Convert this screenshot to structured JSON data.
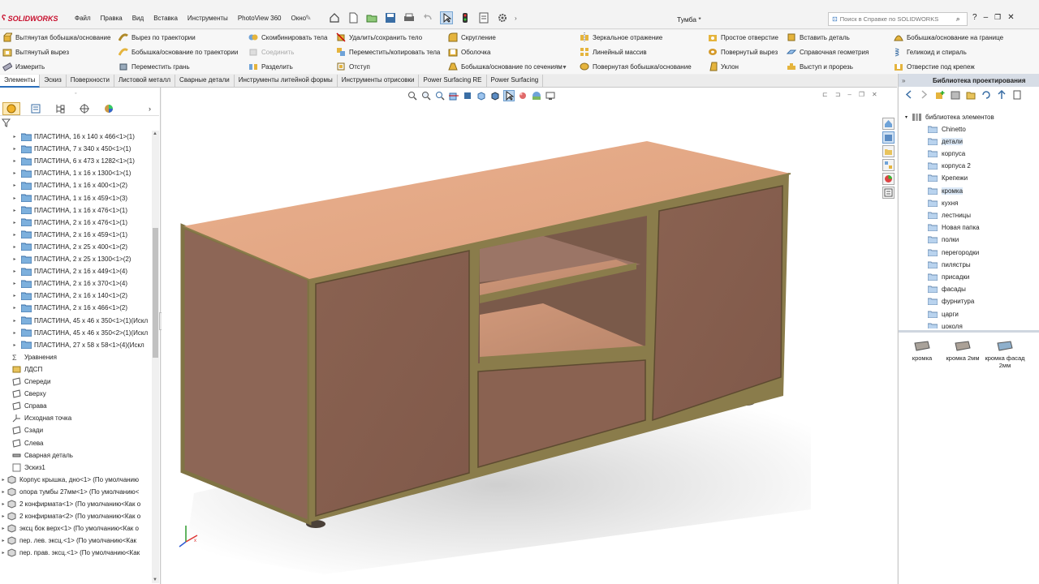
{
  "app": {
    "logo_text": "SOLIDWORKS",
    "document_title": "Тумба *"
  },
  "menu": [
    "Файл",
    "Правка",
    "Вид",
    "Вставка",
    "Инструменты",
    "PhotoView 360",
    "Окно"
  ],
  "help_search": {
    "placeholder": "Поиск в Справке по SOLIDWORKS"
  },
  "ribbon": {
    "col1": [
      "Вытянутая бобышка/основание",
      "Вытянутый вырез",
      "Измерить"
    ],
    "col2": [
      "Вырез по траектории",
      "Бобышка/основание по траектории",
      "Переместить грань"
    ],
    "col3": [
      "Скомбинировать тела",
      "Соединить",
      "Разделить"
    ],
    "col4": [
      "Удалить/сохранить тело",
      "Переместить/копировать тела",
      "Отступ"
    ],
    "col5": [
      "Скругление",
      "Оболочка",
      "Бобышка/основание по сечениям"
    ],
    "col6": [
      "Зеркальное отражение",
      "Линейный массив",
      "Повернутая бобышка/основание"
    ],
    "col7": [
      "Простое отверстие",
      "Повернутый вырез",
      "Уклон"
    ],
    "col8": [
      "Вставить деталь",
      "Справочная геометрия",
      "Выступ и прорезь"
    ],
    "col9": [
      "Бобышка/основание на границе",
      "Геликоид и спираль",
      "Отверстие под крепеж"
    ]
  },
  "tabs": [
    "Элементы",
    "Эскиз",
    "Поверхности",
    "Листовой металл",
    "Сварные детали",
    "Инструменты литейной формы",
    "Инструменты отрисовки",
    "Power Surfacing RE",
    "Power Surfacing"
  ],
  "active_tab": "Элементы",
  "feature_tree": {
    "plates": [
      "ПЛАСТИНА, 16 x 140 x 466<1>(1)",
      "ПЛАСТИНА, 7 x 340 x 450<1>(1)",
      "ПЛАСТИНА, 6 x 473 x 1282<1>(1)",
      "ПЛАСТИНА, 1 x 16 x 1300<1>(1)",
      "ПЛАСТИНА, 1 x 16 x 400<1>(2)",
      "ПЛАСТИНА, 1 x 16 x 459<1>(3)",
      "ПЛАСТИНА, 1 x 16 x 476<1>(1)",
      "ПЛАСТИНА, 2 x 16 x 476<1>(1)",
      "ПЛАСТИНА, 2 x 16 x 459<1>(1)",
      "ПЛАСТИНА, 2 x 25 x 400<1>(2)",
      "ПЛАСТИНА, 2 x 25 x 1300<1>(2)",
      "ПЛАСТИНА, 2 x 16 x 449<1>(4)",
      "ПЛАСТИНА, 2 x 16 x 370<1>(4)",
      "ПЛАСТИНА, 2 x 16 x 140<1>(2)",
      "ПЛАСТИНА, 2 x 16 x 466<1>(2)",
      "ПЛАСТИНА, 45 x 46 x 350<1>(1)(Искл",
      "ПЛАСТИНА, 45 x 46 x 350<2>(1)(Искл",
      "ПЛАСТИНА, 27 x 58 x 58<1>(4)(Искл"
    ],
    "nodes": [
      "Уравнения",
      "ЛДСП",
      "Спереди",
      "Сверху",
      "Справа",
      "Исходная точка",
      "Сзади",
      "Слева",
      "Сварная деталь",
      "Эскиз1"
    ],
    "bodies": [
      "Корпус крышка, дно<1> (По умолчанию",
      "опора тумбы 27мм<1> (По умолчанию<",
      "2 конфирмата<1> (По умолчанию<Как о",
      "2 конфирмата<2> (По умолчанию<Как о",
      "эксц бок верх<1> (По умолчанию<Как о",
      "пер. лев. эксц.<1> (По умолчанию<Как",
      "пер. прав. эксц.<1> (По умолчанию<Как"
    ]
  },
  "library": {
    "header": "Библиотека проектирования",
    "root": "библиотека элементов",
    "folders": [
      "Chinetto",
      "детали",
      "корпуса",
      "корпуса 2",
      "Крепежи",
      "кромка",
      "кухня",
      "лестницы",
      "Новая папка",
      "полки",
      "перегородки",
      "пилястры",
      "присадки",
      "фасады",
      "фурнитура",
      "царги",
      "цоколя"
    ],
    "selected_folder": "кромка",
    "items": [
      "кромка",
      "кромка 2мм",
      "кромка фасад 2мм"
    ]
  },
  "colors": {
    "accent": "#2a6ebb",
    "cabinet_side": "#8a6352",
    "cabinet_top": "#e9b18e",
    "edge_band": "#8a7c4b"
  }
}
